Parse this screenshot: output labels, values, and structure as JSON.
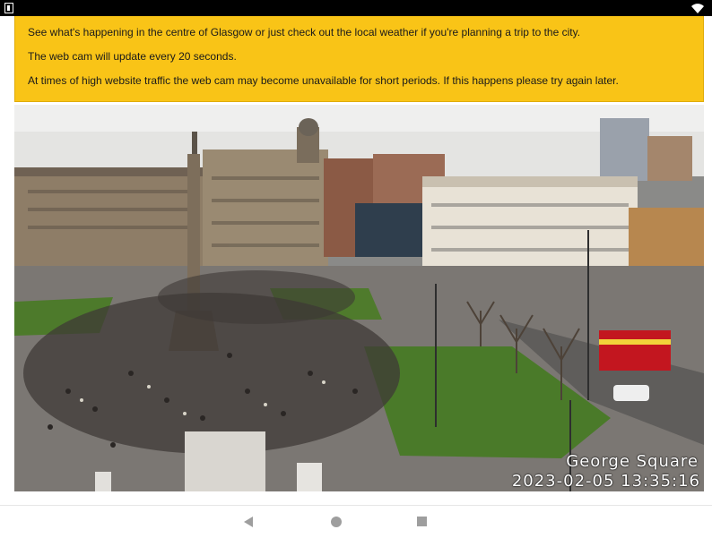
{
  "status_bar": {
    "left_icon": "notification-icon",
    "right_icon": "wifi-icon"
  },
  "info": {
    "line1": "See what's happening in the centre of Glasgow or just check out the local weather if you're planning a trip to the city.",
    "line2": "The web cam will update every 20 seconds.",
    "line3": "At times of high website traffic the web cam may become unavailable for short periods. If this happens please try again later."
  },
  "webcam": {
    "location": "George Square",
    "timestamp": "2023-02-05 13:35:16"
  },
  "nav": {
    "back_icon": "back-triangle-icon",
    "home_icon": "home-circle-icon",
    "recents_icon": "recents-square-icon"
  },
  "colors": {
    "info_background": "#f9c417",
    "status_bar": "#000000"
  }
}
